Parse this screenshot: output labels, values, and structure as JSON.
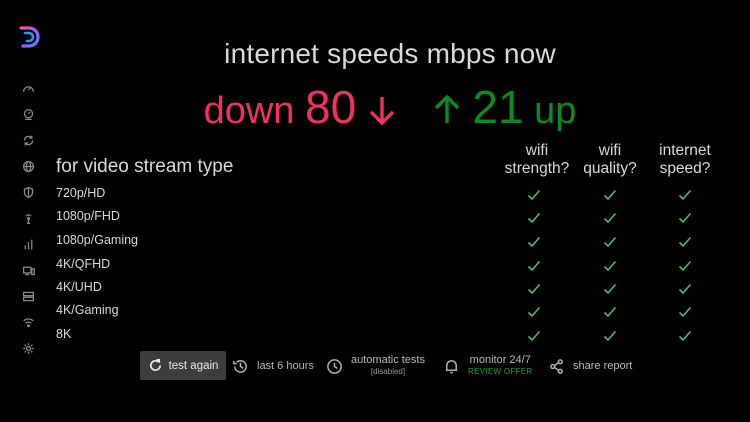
{
  "headline": "internet speeds mbps now",
  "speeds": {
    "down_label": "down",
    "down_value": "80",
    "up_value": "21",
    "up_label": "up"
  },
  "colors": {
    "down": "#f0325c",
    "up": "#0f8a1f",
    "check": "#5fb66b"
  },
  "sidebar": {
    "icons": [
      "speedometer-icon",
      "gauge-icon",
      "refresh-icon",
      "globe-icon",
      "shield-icon",
      "wifi-tower-icon",
      "bar-chart-icon",
      "devices-icon",
      "server-icon",
      "wifi-icon",
      "gear-icon"
    ]
  },
  "table": {
    "title": "for video stream type",
    "columns": [
      {
        "line1": "wifi",
        "line2": "strength?"
      },
      {
        "line1": "wifi",
        "line2": "quality?"
      },
      {
        "line1": "internet",
        "line2": "speed?"
      }
    ],
    "rows": [
      {
        "label": "720p/HD",
        "checks": [
          true,
          true,
          true
        ]
      },
      {
        "label": "1080p/FHD",
        "checks": [
          true,
          true,
          true
        ]
      },
      {
        "label": "1080p/Gaming",
        "checks": [
          true,
          true,
          true
        ]
      },
      {
        "label": "4K/QFHD",
        "checks": [
          true,
          true,
          true
        ]
      },
      {
        "label": "4K/UHD",
        "checks": [
          true,
          true,
          true
        ]
      },
      {
        "label": "4K/Gaming",
        "checks": [
          true,
          true,
          true
        ]
      },
      {
        "label": "8K",
        "checks": [
          true,
          true,
          true
        ]
      }
    ]
  },
  "toolbar": {
    "test_again": "test again",
    "last_hours": "last 6 hours",
    "auto_tests": "automatic tests",
    "auto_tests_sub": "[disabled]",
    "monitor": "monitor 24/7",
    "monitor_sub": "REVIEW OFFER",
    "share": "share report"
  }
}
